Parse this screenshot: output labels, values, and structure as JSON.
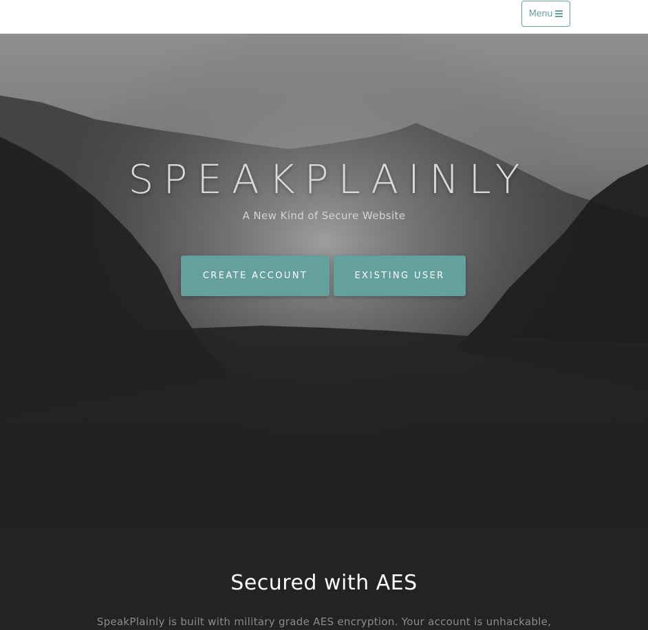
{
  "nav": {
    "menu_label": "Menu",
    "menu_icon": "bars-icon"
  },
  "hero": {
    "title": "SPEAKPLAINLY",
    "subtitle": "A New Kind of Secure Website",
    "buttons": {
      "create_account": "CREATE ACCOUNT",
      "existing_user": "EXISTING USER"
    }
  },
  "about": {
    "title": "Secured with AES",
    "text": "SpeakPlainly is built with military grade AES encryption. Your account is unhackable,"
  },
  "colors": {
    "accent": "#64a19d",
    "background_dark": "#232323",
    "nav_background": "#ffffff"
  }
}
